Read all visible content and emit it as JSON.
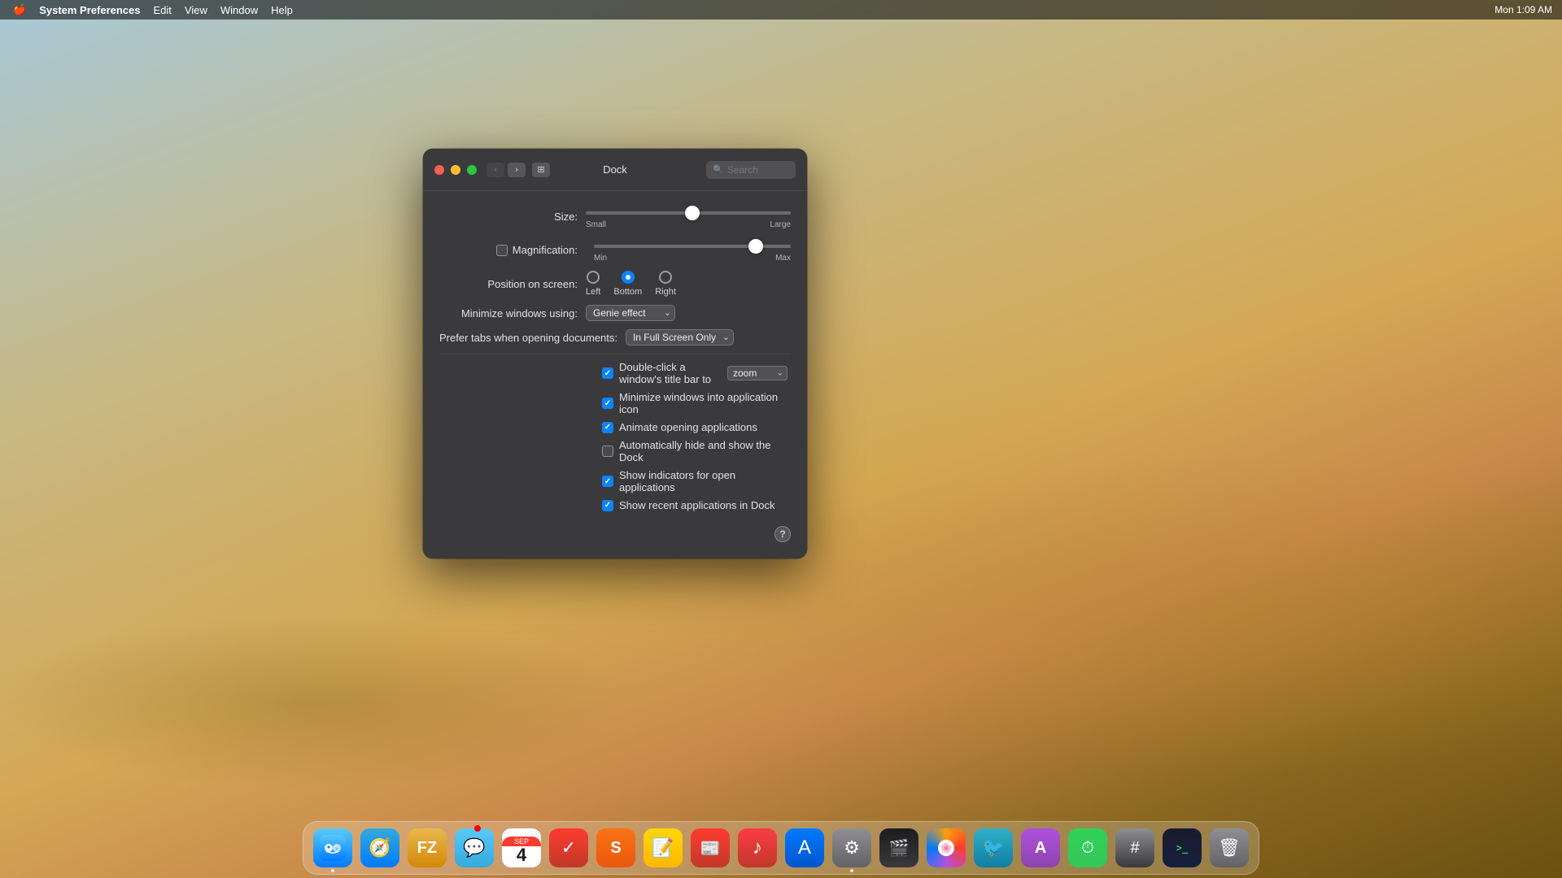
{
  "menubar": {
    "apple": "🍎",
    "app_name": "System Preferences",
    "menu_items": [
      "Edit",
      "View",
      "Window",
      "Help"
    ],
    "right_items": [
      "Mon 1:09 AM"
    ],
    "time": "Mon 1:09 AM"
  },
  "window": {
    "title": "Dock",
    "search_placeholder": "Search",
    "size_label": "Size:",
    "size_small": "Small",
    "size_large": "Large",
    "size_value": 52,
    "magnification_label": "Magnification:",
    "mag_min": "Min",
    "mag_max": "Max",
    "position_label": "Position on screen:",
    "position_left": "Left",
    "position_bottom": "Bottom",
    "position_right": "Right",
    "minimize_label": "Minimize windows using:",
    "minimize_value": "Genie effect",
    "tabs_label": "Prefer tabs when opening documents:",
    "tabs_value": "In Full Screen Only",
    "double_click_label": "Double-click a window's title bar to",
    "double_click_action": "zoom",
    "minimize_app_icon_label": "Minimize windows into application icon",
    "animate_label": "Animate opening applications",
    "auto_hide_label": "Automatically hide and show the Dock",
    "show_indicators_label": "Show indicators for open applications",
    "show_recent_label": "Show recent applications in Dock",
    "checkboxes": {
      "double_click": true,
      "minimize_app_icon": true,
      "animate": true,
      "auto_hide": false,
      "show_indicators": true,
      "show_recent": true
    }
  },
  "dock": {
    "items": [
      {
        "name": "Finder",
        "icon_class": "finder-icon",
        "icon": "🔵",
        "has_dot": true
      },
      {
        "name": "Safari",
        "icon_class": "safari-icon",
        "icon": "🧭",
        "has_dot": false
      },
      {
        "name": "FileZilla",
        "icon_class": "filezilla-icon",
        "icon": "📁",
        "has_dot": false
      },
      {
        "name": "Messages",
        "icon_class": "messages-icon",
        "icon": "💬",
        "has_dot": false
      },
      {
        "name": "Calendar",
        "icon_class": "calendar-icon",
        "icon": "📅",
        "has_dot": false
      },
      {
        "name": "OmniFocus",
        "icon_class": "omnifocus-icon",
        "icon": "✓",
        "has_dot": false
      },
      {
        "name": "Sublime Text",
        "icon_class": "sublime-icon",
        "icon": "S",
        "has_dot": false
      },
      {
        "name": "Stickies",
        "icon_class": "stickies-icon",
        "icon": "📝",
        "has_dot": false
      },
      {
        "name": "News",
        "icon_class": "news-icon",
        "icon": "📰",
        "has_dot": false
      },
      {
        "name": "iTunes",
        "icon_class": "itunes-icon",
        "icon": "♪",
        "has_dot": false
      },
      {
        "name": "App Store",
        "icon_class": "appstore-icon",
        "icon": "A",
        "has_dot": false
      },
      {
        "name": "System Preferences",
        "icon_class": "sysprefs-icon",
        "icon": "⚙",
        "has_dot": true
      },
      {
        "name": "Claquette",
        "icon_class": "claquette-icon",
        "icon": "🎬",
        "has_dot": false
      },
      {
        "name": "Photos",
        "icon_class": "photos-icon",
        "icon": "🌸",
        "has_dot": false
      },
      {
        "name": "Wail",
        "icon_class": "wail-icon",
        "icon": "🐦",
        "has_dot": false
      },
      {
        "name": "Affinity Photo",
        "icon_class": "affinity-icon",
        "icon": "A",
        "has_dot": false
      },
      {
        "name": "Timing",
        "icon_class": "time-icon",
        "icon": "⏱",
        "has_dot": false
      },
      {
        "name": "Calculator",
        "icon_class": "calculator-icon",
        "icon": "#",
        "has_dot": false
      },
      {
        "name": "iTerm",
        "icon_class": "iterm-icon",
        "icon": ">_",
        "has_dot": false
      },
      {
        "name": "Trash",
        "icon_class": "trash-icon",
        "icon": "🗑",
        "has_dot": false
      }
    ]
  }
}
